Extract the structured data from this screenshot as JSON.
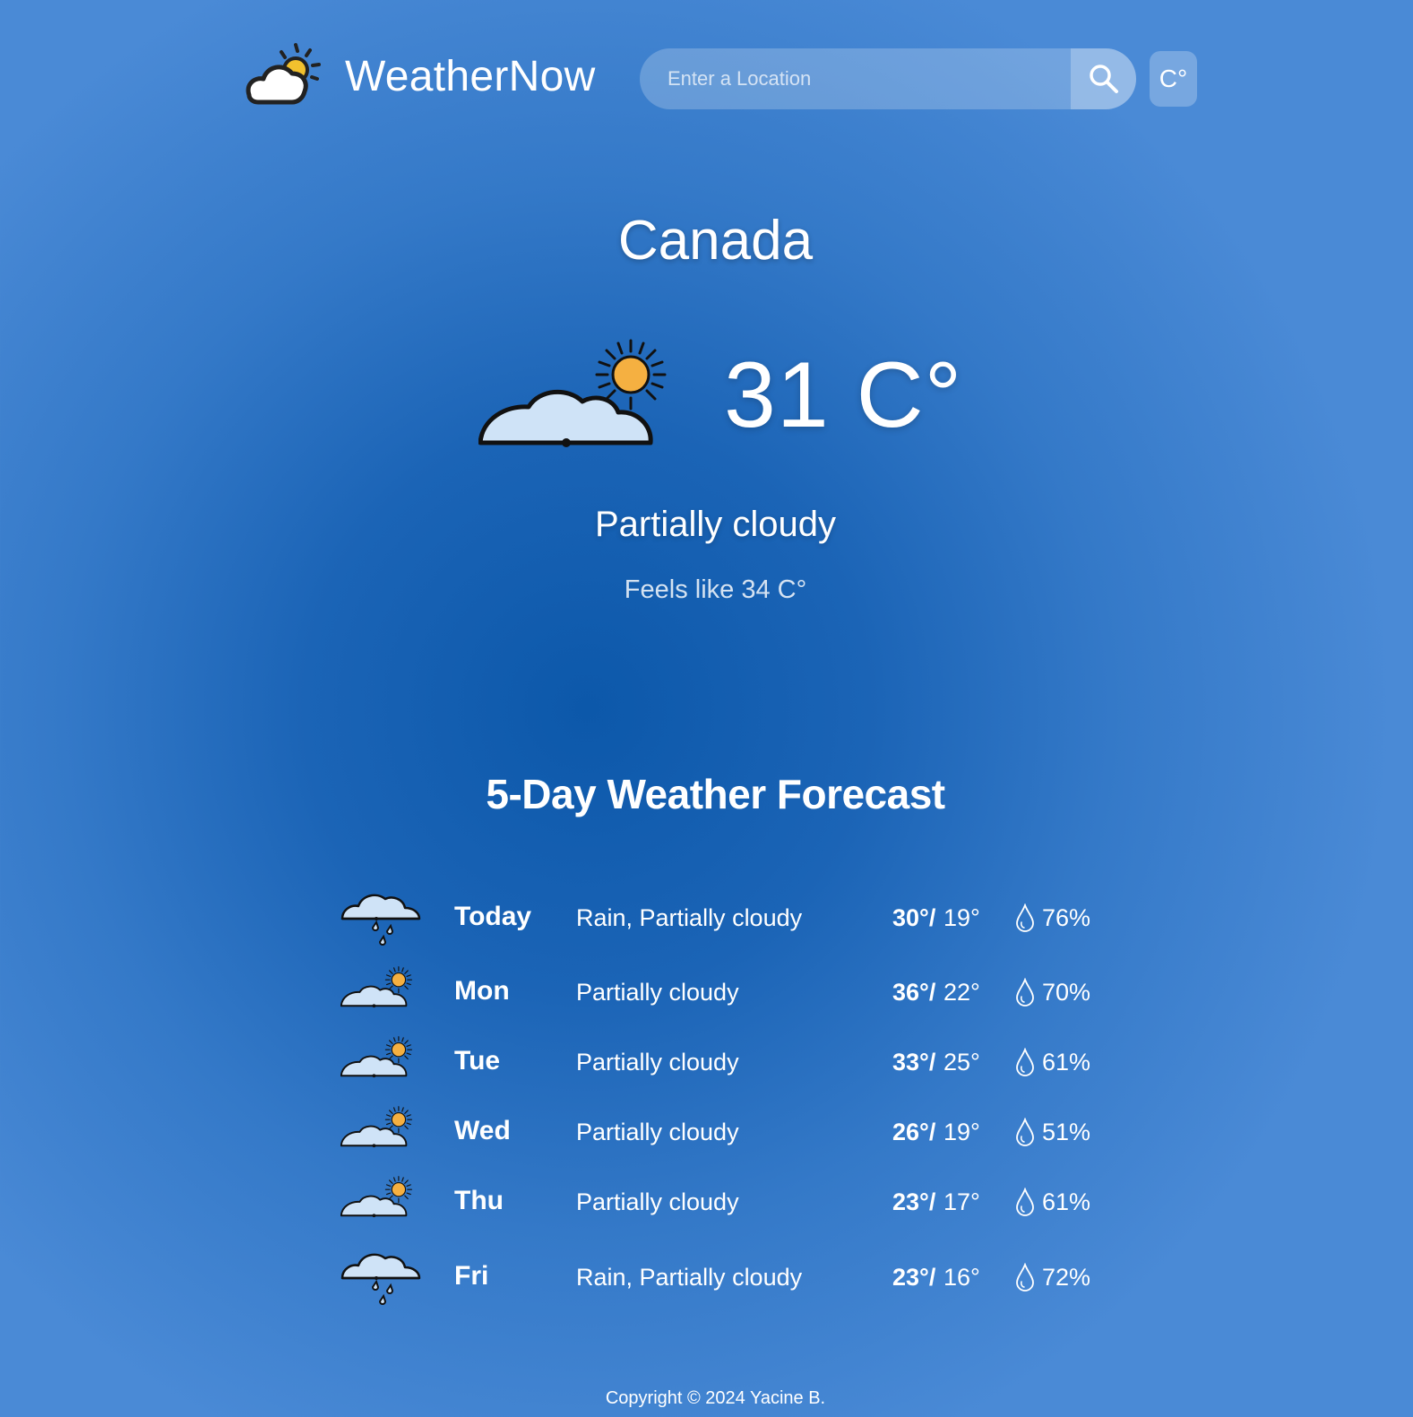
{
  "header": {
    "app_title": "WeatherNow",
    "logo_icon": "sun-behind-cloud-icon",
    "search": {
      "placeholder": "Enter a Location",
      "value": "",
      "button_icon": "search-icon"
    },
    "unit_toggle_label": "C°"
  },
  "current": {
    "location": "Canada",
    "icon": "partly-cloudy-icon",
    "temperature": "31 C°",
    "condition": "Partially cloudy",
    "feels_like": "Feels like 34 C°"
  },
  "forecast": {
    "title": "5-Day Weather Forecast",
    "days": [
      {
        "day": "Today",
        "icon": "rain-cloud-icon",
        "condition": "Rain, Partially cloudy",
        "high": "30°/",
        "low": "19°",
        "precip_icon": "droplet-icon",
        "precip": "76%"
      },
      {
        "day": "Mon",
        "icon": "partly-cloudy-icon",
        "condition": "Partially cloudy",
        "high": "36°/",
        "low": "22°",
        "precip_icon": "droplet-icon",
        "precip": "70%"
      },
      {
        "day": "Tue",
        "icon": "partly-cloudy-icon",
        "condition": "Partially cloudy",
        "high": "33°/",
        "low": "25°",
        "precip_icon": "droplet-icon",
        "precip": "61%"
      },
      {
        "day": "Wed",
        "icon": "partly-cloudy-icon",
        "condition": "Partially cloudy",
        "high": "26°/",
        "low": "19°",
        "precip_icon": "droplet-icon",
        "precip": "51%"
      },
      {
        "day": "Thu",
        "icon": "partly-cloudy-icon",
        "condition": "Partially cloudy",
        "high": "23°/",
        "low": "17°",
        "precip_icon": "droplet-icon",
        "precip": "61%"
      },
      {
        "day": "Fri",
        "icon": "rain-cloud-icon",
        "condition": "Rain, Partially cloudy",
        "high": "23°/",
        "low": "16°",
        "precip_icon": "droplet-icon",
        "precip": "72%"
      }
    ]
  },
  "footer": {
    "copyright": "Copyright © 2024 Yacine B."
  },
  "colors": {
    "background_center": "#0c58aa",
    "background_edge": "#4a8ad6",
    "sun": "#f5b041",
    "cloud": "#cfe3f7",
    "text": "#ffffff"
  }
}
